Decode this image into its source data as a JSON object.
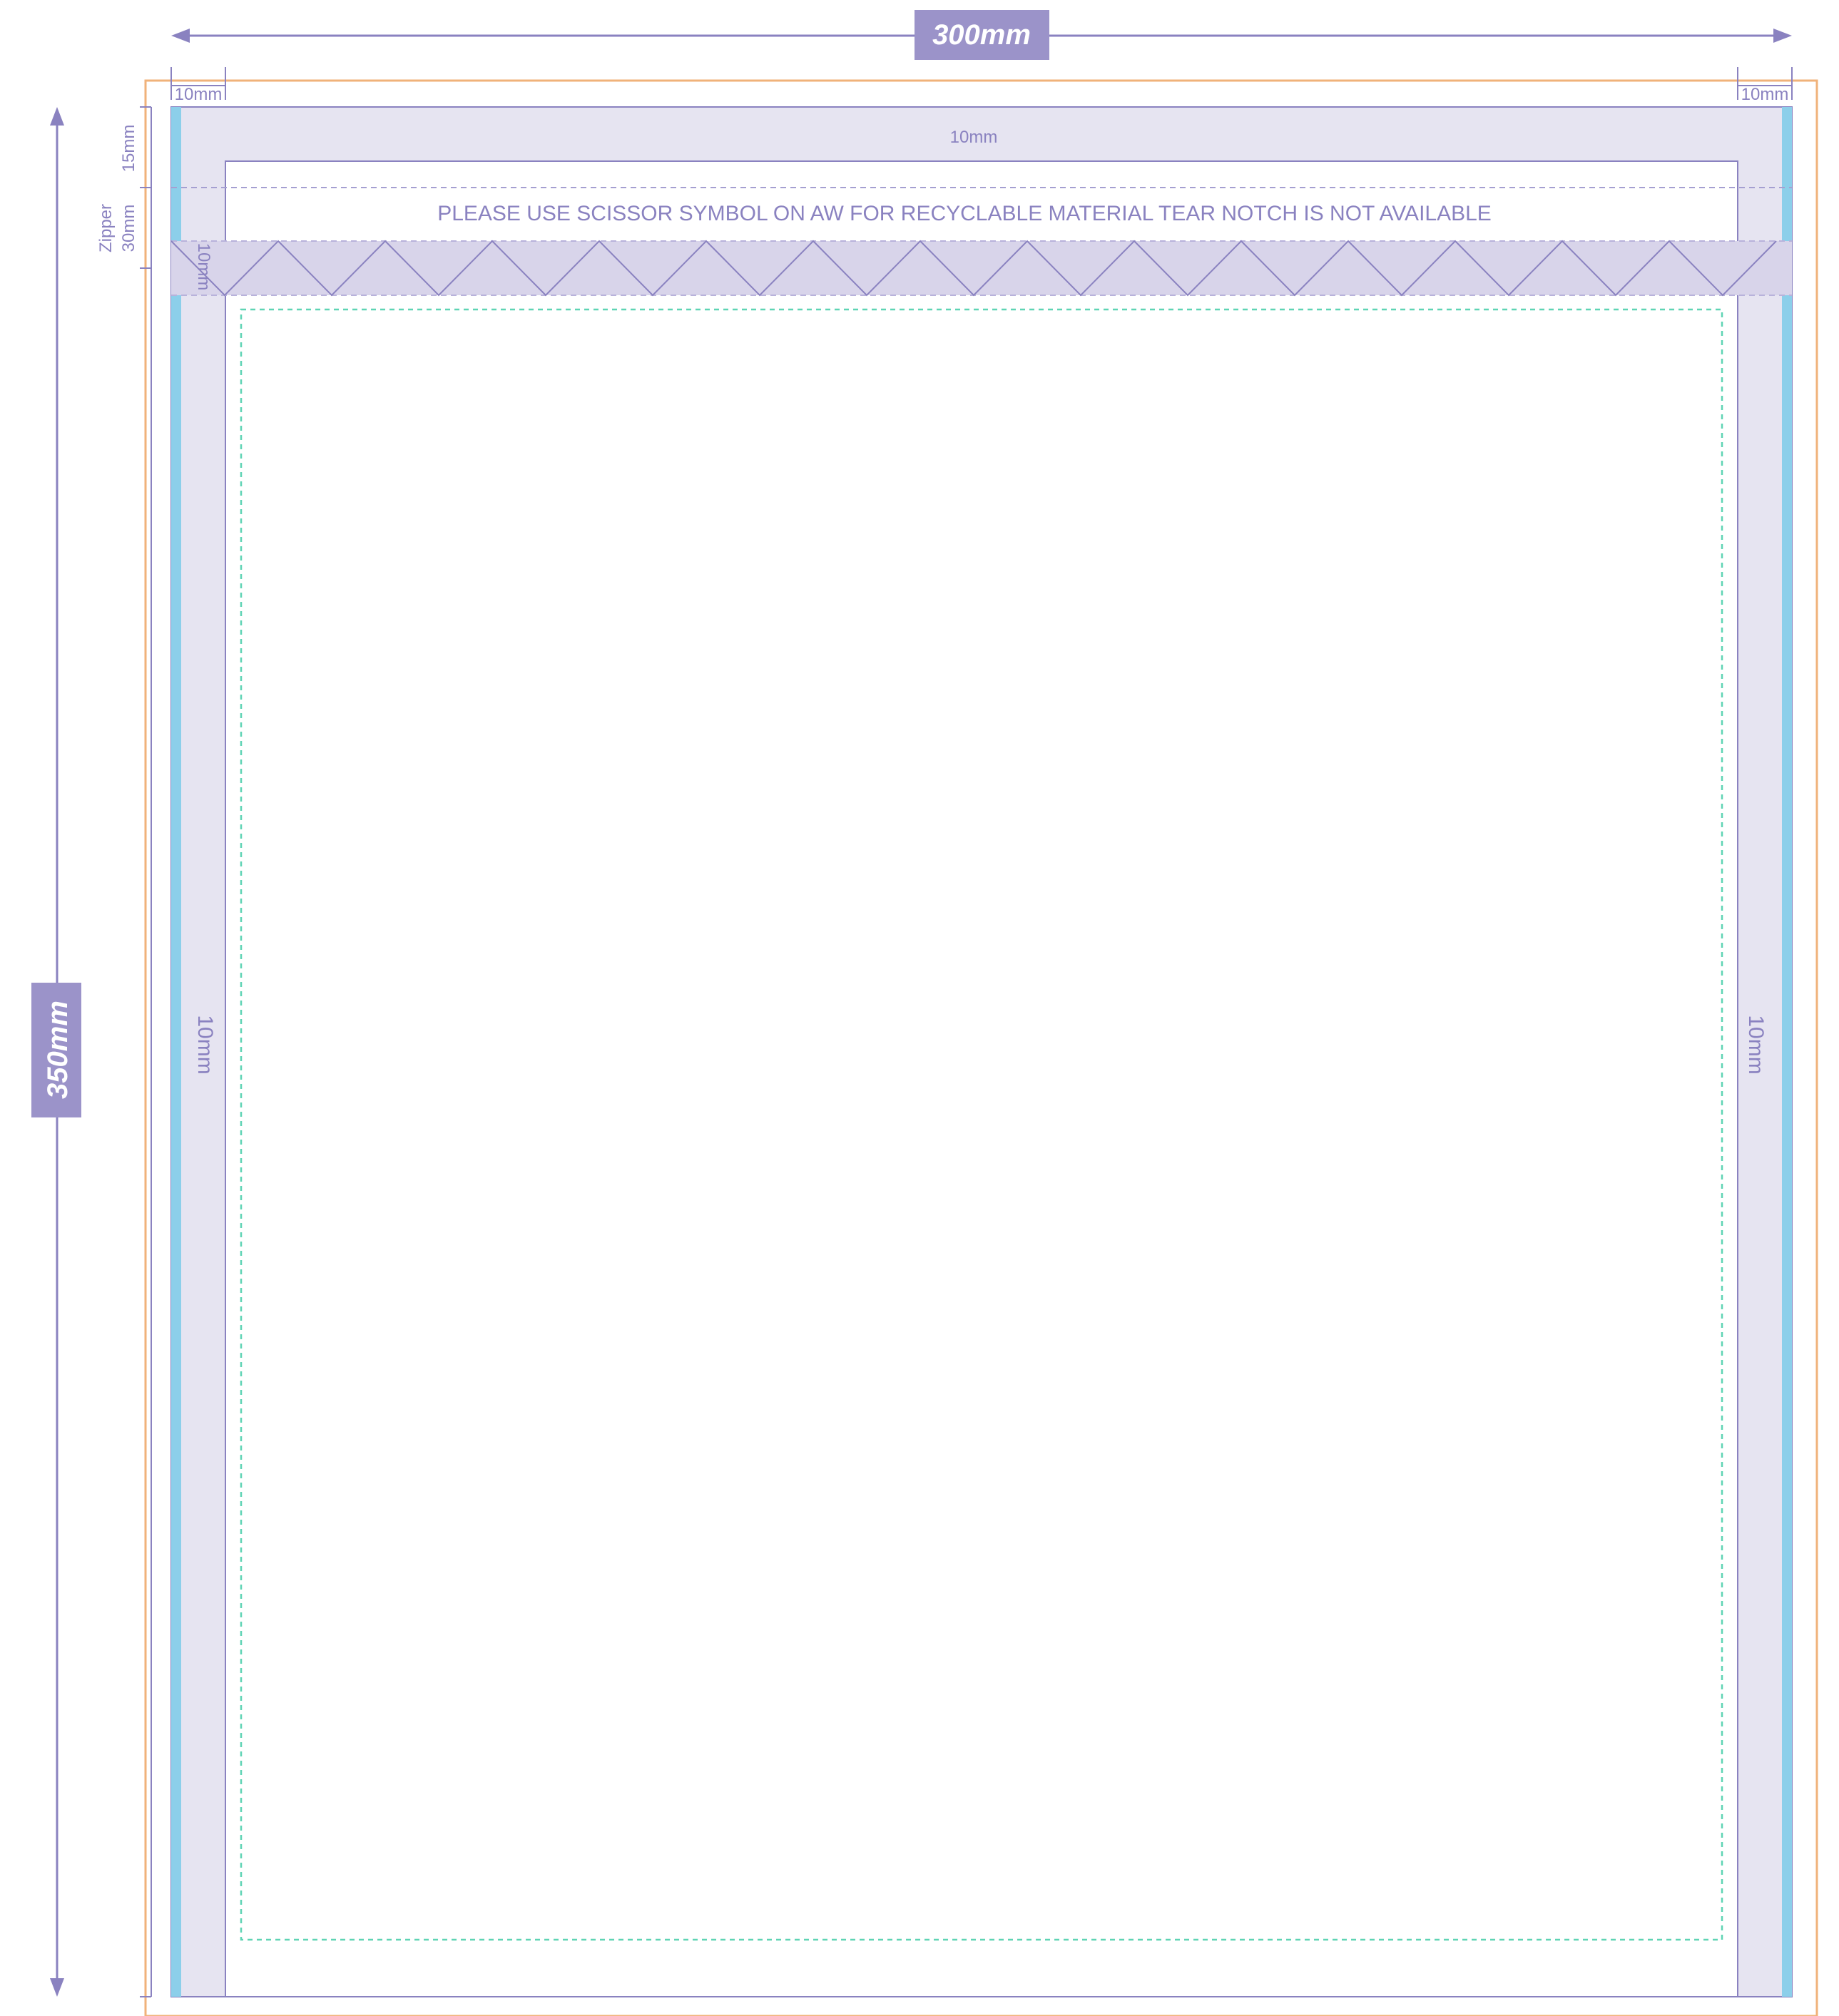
{
  "dimensions": {
    "width_label": "300mm",
    "height_label": "350mm"
  },
  "margins": {
    "left_seal": "10mm",
    "right_seal": "10mm",
    "top_seal": "10mm",
    "side_left_seal": "10mm",
    "side_right_seal": "10mm",
    "zipper_seal": "10mm",
    "top_allowance": "15mm",
    "zipper_height": "30mm",
    "zipper_label": "Zipper"
  },
  "notice": "PLEASE USE SCISSOR SYMBOL ON AW FOR RECYCLABLE MATERIAL TEAR NOTCH IS NOT AVAILABLE",
  "colors": {
    "dimension": "#8a82c0",
    "seal_fill": "#e6e4f1",
    "zipper_fill": "#d8d4ea",
    "bleed_edge": "#f0b27a",
    "side_bar": "#8ccfea",
    "safe_zone": "#5fd4b4",
    "label_bg": "#9b93c9"
  }
}
